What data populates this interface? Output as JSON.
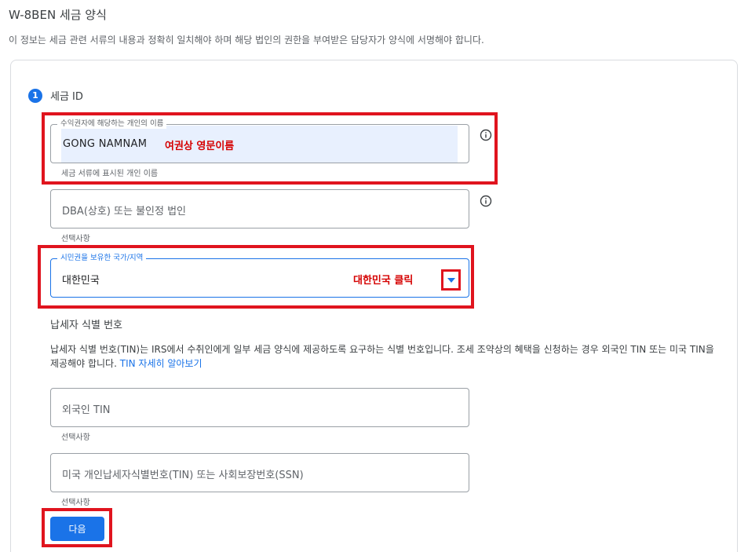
{
  "header": {
    "title": "W-8BEN 세금 양식",
    "description": "이 정보는 세금 관련 서류의 내용과 정확히 일치해야 하며 해당 법인의 권한을 부여받은 담당자가 양식에 서명해야 합니다."
  },
  "step": {
    "number": "1",
    "label": "세금 ID"
  },
  "fields": {
    "individual_name": {
      "legend": "수익권자에 해당하는 개인의 이름",
      "value": "GONG NAMNAM",
      "annotation": "여권상 영문이름",
      "helper": "세금 서류에 표시된 개인 이름"
    },
    "dba": {
      "placeholder": "DBA(상호) 또는 불인정 법인",
      "helper": "선택사항"
    },
    "country": {
      "legend": "시민권을 보유한 국가/지역",
      "value": "대한민국",
      "annotation": "대한민국 클릭"
    },
    "foreign_tin": {
      "placeholder": "외국인 TIN",
      "helper": "선택사항"
    },
    "us_tin": {
      "placeholder": "미국 개인납세자식별번호(TIN) 또는 사회보장번호(SSN)",
      "helper": "선택사항"
    }
  },
  "tin_section": {
    "title": "납세자 식별 번호",
    "description": "납세자 식별 번호(TIN)는 IRS에서 수취인에게 일부 세금 양식에 제공하도록 요구하는 식별 번호입니다. 조세 조약상의 혜택을 신청하는 경우 외국인 TIN 또는 미국 TIN을 제공해야 합니다.",
    "link": "TIN 자세히 알아보기"
  },
  "next_button": {
    "label": "다음"
  },
  "colors": {
    "accent": "#1a73e8",
    "annotation_red": "#d50000",
    "highlight_box": "#e0141e"
  },
  "icons": {
    "info": "info-icon",
    "dropdown": "dropdown-arrow-icon"
  }
}
